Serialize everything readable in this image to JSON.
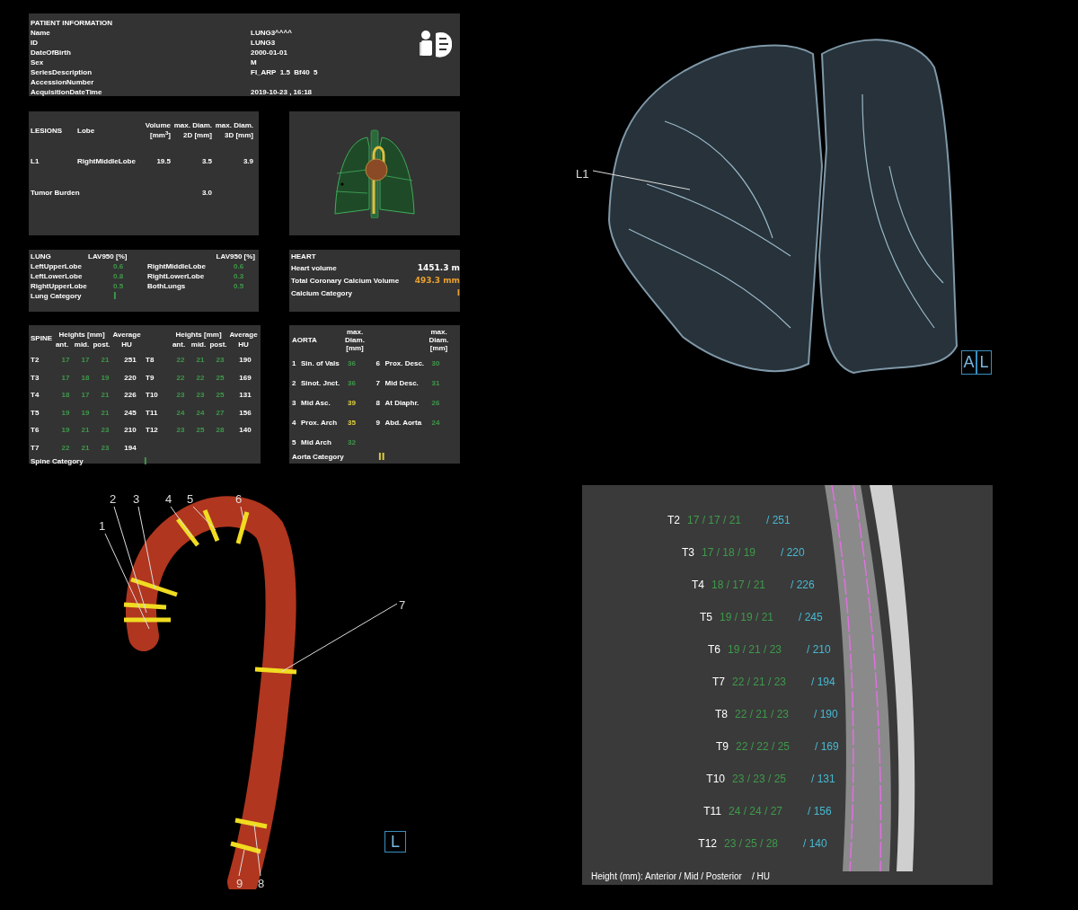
{
  "patient_information": {
    "title": "PATIENT INFORMATION",
    "fields": [
      {
        "label": "Name",
        "value": "LUNG3^^^^"
      },
      {
        "label": "ID",
        "value": "LUNG3"
      },
      {
        "label": "DateOfBirth",
        "value": "2000-01-01"
      },
      {
        "label": "Sex",
        "value": "M"
      },
      {
        "label": "SeriesDescription",
        "value": "FI_ARP  1.5  Bf40  5"
      },
      {
        "label": "AccessionNumber"
      },
      {
        "label": "AcquisitionDateTime",
        "value": "2019-10-23 , 16:18"
      }
    ]
  },
  "lesions": {
    "title": "LESIONS",
    "columns": [
      "Lobe",
      "Volume [mm$^{3}$]",
      "max. Diam. 2D [mm]",
      "max. Diam. 3D [mm]"
    ],
    "rows": [
      {
        "name": "L1",
        "lobe": "RightMiddleLobe",
        "volume": "19.5",
        "diam_2d": "3.5",
        "diam_3d": "3.9"
      }
    ],
    "tumor_burden": {
      "label": "Tumor Burden",
      "value": "3.0"
    }
  },
  "lung": {
    "title": "LUNG",
    "column_headers": [
      "LAV950 [%]",
      "LAV950 [%]"
    ],
    "lobes": [
      {
        "label": "LeftUpperLobe",
        "value": "0.6"
      },
      {
        "label": "RightMiddleLobe",
        "value": "0.6"
      },
      {
        "label": "LeftLowerLobe",
        "value": "0.8"
      },
      {
        "label": "RightLowerLobe",
        "value": "0.3"
      },
      {
        "label": "RightUpperLobe",
        "value": "0.5"
      },
      {
        "label": "BothLungs",
        "value": "0.5"
      }
    ],
    "category": {
      "label": "Lung Category",
      "value": "I",
      "color": "#3e9a4a"
    }
  },
  "heart": {
    "title": "HEART",
    "rows": [
      {
        "label": "Heart volume",
        "value": "1451.3 m",
        "color": "#ffffff"
      },
      {
        "label": "Total Coronary Calcium Volume",
        "value": "493.3 mm",
        "color": "#e8a030"
      },
      {
        "label": "Calcium Category",
        "value": "I",
        "color": "#e8a030"
      }
    ]
  },
  "spine": {
    "title": "SPINE",
    "columns": [
      {
        "heights_label": "Heights [mm]",
        "average_label": "Average",
        "sub_labels": [
          "ant.",
          "mid.",
          "post."
        ],
        "hu_label": "HU",
        "rows": [
          {
            "level": "T2",
            "ant": "17",
            "mid": "17",
            "post": "21",
            "hu": "251"
          },
          {
            "level": "T3",
            "ant": "17",
            "mid": "18",
            "post": "19",
            "hu": "220"
          },
          {
            "level": "T4",
            "ant": "18",
            "mid": "17",
            "post": "21",
            "hu": "226"
          },
          {
            "level": "T5",
            "ant": "19",
            "mid": "19",
            "post": "21",
            "hu": "245"
          },
          {
            "level": "T6",
            "ant": "19",
            "mid": "21",
            "post": "23",
            "hu": "210"
          },
          {
            "level": "T7",
            "ant": "22",
            "mid": "21",
            "post": "23",
            "hu": "194"
          }
        ]
      },
      {
        "heights_label": "Heights [mm]",
        "average_label": "Average",
        "sub_labels": [
          "ant.",
          "mid.",
          "post."
        ],
        "hu_label": "HU",
        "rows": [
          {
            "level": "T8",
            "ant": "22",
            "mid": "21",
            "post": "23",
            "hu": "190"
          },
          {
            "level": "T9",
            "ant": "22",
            "mid": "22",
            "post": "25",
            "hu": "169"
          },
          {
            "level": "T10",
            "ant": "23",
            "mid": "23",
            "post": "25",
            "hu": "131"
          },
          {
            "level": "T11",
            "ant": "24",
            "mid": "24",
            "post": "27",
            "hu": "156"
          },
          {
            "level": "T12",
            "ant": "23",
            "mid": "25",
            "post": "28",
            "hu": "140"
          }
        ]
      }
    ],
    "category": {
      "label": "Spine Category",
      "value": "I",
      "color": "#3e9a4a"
    }
  },
  "aorta": {
    "title": "AORTA",
    "columns": [
      {
        "header": "max. Diam. [mm]",
        "items": [
          {
            "number": "1",
            "name": "Sin. of Vals",
            "value": "36",
            "color": "#3e9a4a"
          },
          {
            "number": "2",
            "name": "Sinot. Jnct.",
            "value": "36",
            "color": "#3e9a4a"
          },
          {
            "number": "3",
            "name": "Mid Asc.",
            "value": "39",
            "color": "#e0d040"
          },
          {
            "number": "4",
            "name": "Prox. Arch",
            "value": "35",
            "color": "#e0d040"
          },
          {
            "number": "5",
            "name": "Mid Arch",
            "value": "32",
            "color": "#3e9a4a"
          }
        ]
      },
      {
        "header": "max. Diam. [mm]",
        "items": [
          {
            "number": "6",
            "name": "Prox. Desc.",
            "value": "30",
            "color": "#3e9a4a"
          },
          {
            "number": "7",
            "name": "Mid Desc.",
            "value": "31",
            "color": "#3e9a4a"
          },
          {
            "number": "8",
            "name": "At Diaphr.",
            "value": "26",
            "color": "#3e9a4a"
          },
          {
            "number": "9",
            "name": "Abd. Aorta",
            "value": "24",
            "color": "#3e9a4a"
          }
        ]
      }
    ],
    "category": {
      "label": "Aorta Category",
      "value": "II",
      "color": "#e0d040"
    }
  },
  "lung_render": {
    "lesion_label": "L1",
    "orientation": [
      "A",
      "L"
    ]
  },
  "aorta_render": {
    "markers": [
      "1",
      "2",
      "3",
      "4",
      "5",
      "6",
      "7",
      "8",
      "9"
    ],
    "orientation": "L"
  },
  "spine_ct": {
    "levels": [
      {
        "label": "T2",
        "heights": "17 / 17 / 21",
        "hu": "/ 251"
      },
      {
        "label": "T3",
        "heights": "17 / 18 / 19",
        "hu": "/ 220"
      },
      {
        "label": "T4",
        "heights": "18 / 17 / 21",
        "hu": "/ 226"
      },
      {
        "label": "T5",
        "heights": "19 / 19 / 21",
        "hu": "/ 245"
      },
      {
        "label": "T6",
        "heights": "19 / 21 / 23",
        "hu": "/ 210"
      },
      {
        "label": "T7",
        "heights": "22 / 21 / 23",
        "hu": "/ 194"
      },
      {
        "label": "T8",
        "heights": "22 / 21 / 23",
        "hu": "/ 190"
      },
      {
        "label": "T9",
        "heights": "22 / 22 / 25",
        "hu": "/ 169"
      },
      {
        "label": "T10",
        "heights": "23 / 23 / 25",
        "hu": "/ 131"
      },
      {
        "label": "T11",
        "heights": "24 / 24 / 27",
        "hu": "/ 156"
      },
      {
        "label": "T12",
        "heights": "23 / 25 / 28",
        "hu": "/ 140"
      }
    ],
    "legend": "Height (mm): Anterior / Mid / Posterior    / HU"
  }
}
